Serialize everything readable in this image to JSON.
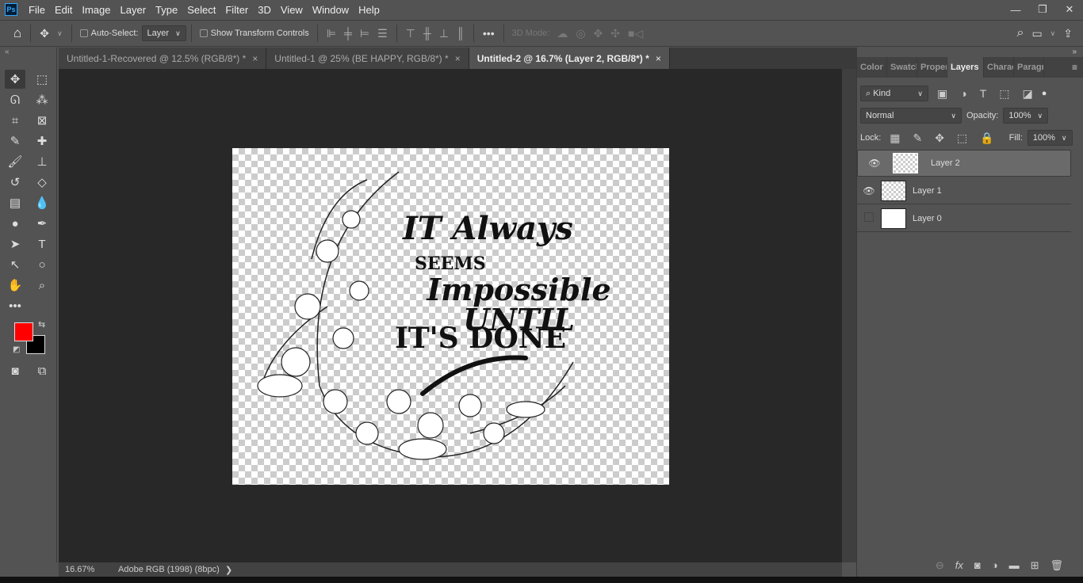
{
  "menubar": {
    "logo": "Ps",
    "items": [
      "File",
      "Edit",
      "Image",
      "Layer",
      "Type",
      "Select",
      "Filter",
      "3D",
      "View",
      "Window",
      "Help"
    ],
    "window_controls": [
      "minimize",
      "restore",
      "close"
    ]
  },
  "options": {
    "auto_select_label": "Auto-Select:",
    "auto_select_checked": false,
    "auto_select_target": "Layer",
    "show_transform_label": "Show Transform Controls",
    "show_transform_checked": false,
    "more": "•••",
    "mode_3d_label": "3D Mode:"
  },
  "tabs": [
    {
      "label": "Untitled-1-Recovered @ 12.5% (RGB/8*) *",
      "active": false
    },
    {
      "label": "Untitled-1 @ 25% (BE HAPPY, RGB/8*) *",
      "active": false
    },
    {
      "label": "Untitled-2 @ 16.7% (Layer 2, RGB/8*) *",
      "active": true
    }
  ],
  "colors": {
    "foreground": "#ff0000",
    "background": "#000000"
  },
  "artwork": {
    "lines": [
      "IT Always",
      "SEEMS",
      "Impossible UNTIL",
      "IT'S DONE"
    ]
  },
  "status": {
    "zoom": "16.67%",
    "profile": "Adobe RGB (1998) (8bpc)",
    "arrow": "❯"
  },
  "panel": {
    "tabs": [
      "Color",
      "Swatch",
      "Proper",
      "Layers",
      "Charac",
      "Paragr"
    ],
    "active_tab": "Layers",
    "filter_kind": "Kind",
    "blend_mode": "Normal",
    "opacity_label": "Opacity:",
    "opacity": "100%",
    "lock_label": "Lock:",
    "fill_label": "Fill:",
    "fill": "100%",
    "layers": [
      {
        "name": "Layer 2",
        "visible": true,
        "selected": true
      },
      {
        "name": "Layer 1",
        "visible": true,
        "selected": false
      },
      {
        "name": "Layer 0",
        "visible": false,
        "selected": false
      }
    ]
  }
}
